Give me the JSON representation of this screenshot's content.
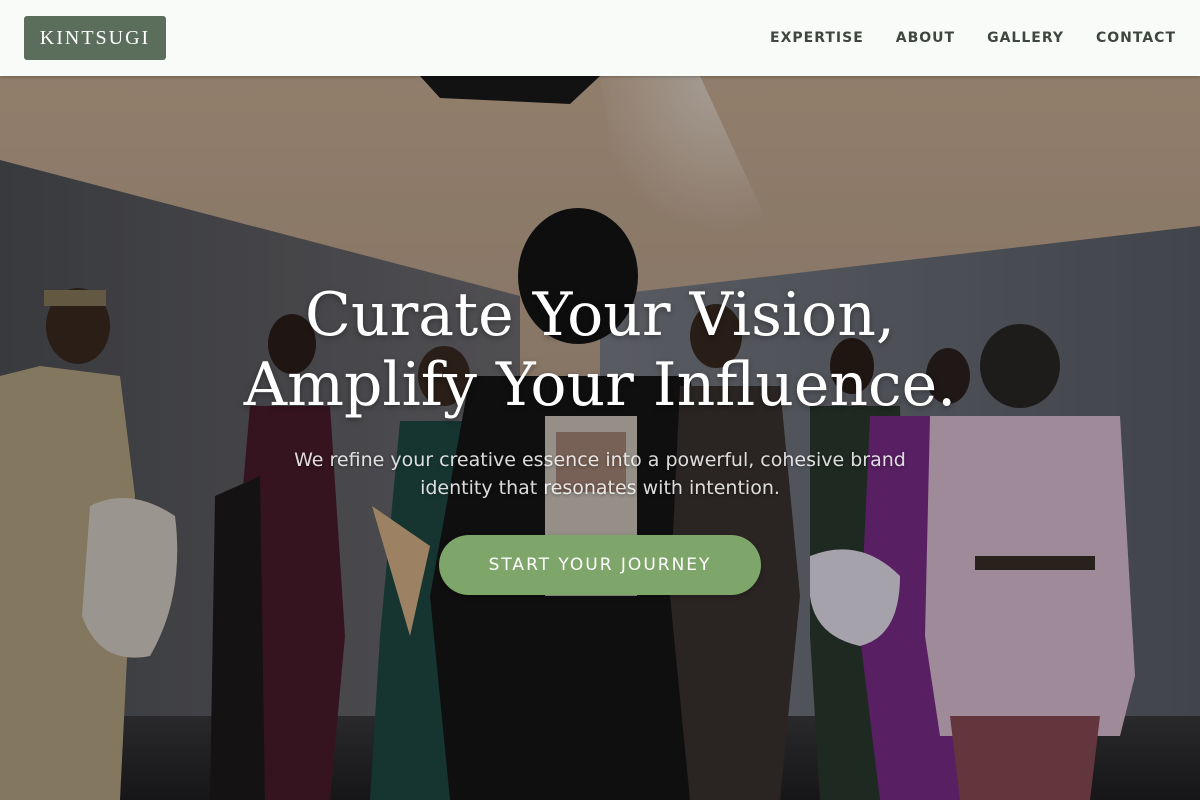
{
  "header": {
    "logo": "KINTSUGI",
    "nav": [
      {
        "label": "EXPERTISE"
      },
      {
        "label": "ABOUT"
      },
      {
        "label": "GALLERY"
      },
      {
        "label": "CONTACT"
      }
    ]
  },
  "hero": {
    "title_line1": "Curate Your Vision,",
    "title_line2": "Amplify Your Influence.",
    "subtitle_line1": "We refine your creative essence into a powerful, cohesive brand",
    "subtitle_line2": "identity that resonates with intention.",
    "cta_label": "START YOUR JOURNEY",
    "image_description": "fashion-group-backstage-photo"
  },
  "colors": {
    "header_bg": "#f9fbf8",
    "logo_bg": "#5b6d5b",
    "nav_text": "#3f463f",
    "cta_bg": "#7ea56a",
    "hero_text": "#ffffff"
  }
}
